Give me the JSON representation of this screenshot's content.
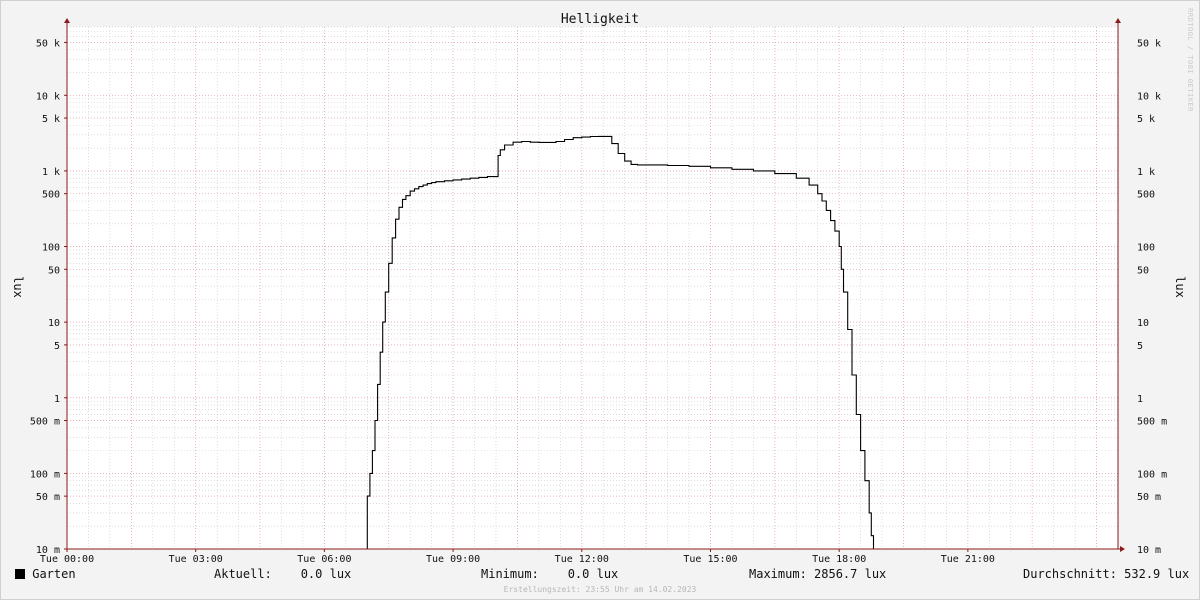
{
  "chart_data": {
    "type": "line",
    "title": "Helligkeit",
    "ylabel": "lux",
    "y_scale": "log",
    "ylim": [
      0.01,
      80000
    ],
    "xlim_hours": [
      0,
      24.5
    ],
    "x_tick_labels": [
      "Tue 00:00",
      "Tue 03:00",
      "Tue 06:00",
      "Tue 09:00",
      "Tue 12:00",
      "Tue 15:00",
      "Tue 18:00",
      "Tue 21:00"
    ],
    "x_tick_hours": [
      0,
      3,
      6,
      9,
      12,
      15,
      18,
      21
    ],
    "y_tick_values": [
      0.01,
      0.05,
      0.1,
      0.5,
      1,
      5,
      10,
      50,
      100,
      500,
      1000,
      5000,
      10000,
      50000
    ],
    "y_tick_labels": [
      "10 m",
      "50 m",
      "100 m",
      "500 m",
      "1",
      "5",
      "10",
      "50",
      "100",
      "500",
      "1 k",
      "5 k",
      "10 k",
      "50 k"
    ],
    "grid": true,
    "series": [
      {
        "name": "Garten",
        "color": "#000000",
        "x_hours": [
          0,
          6.0,
          6.87,
          7.0,
          7.06,
          7.12,
          7.18,
          7.24,
          7.3,
          7.36,
          7.42,
          7.5,
          7.58,
          7.66,
          7.74,
          7.82,
          7.9,
          8.0,
          8.1,
          8.2,
          8.3,
          8.4,
          8.5,
          8.6,
          8.8,
          9.0,
          9.2,
          9.4,
          9.6,
          9.8,
          10.05,
          10.1,
          10.2,
          10.4,
          10.6,
          10.8,
          11.0,
          11.2,
          11.4,
          11.6,
          11.8,
          12.0,
          12.2,
          12.4,
          12.7,
          12.85,
          13.0,
          13.15,
          13.3,
          13.5,
          14.0,
          14.5,
          15.0,
          15.5,
          16.0,
          16.5,
          17.0,
          17.3,
          17.5,
          17.6,
          17.7,
          17.8,
          17.9,
          18.0,
          18.05,
          18.1,
          18.2,
          18.3,
          18.4,
          18.5,
          18.6,
          18.7,
          18.75,
          18.8,
          18.85,
          18.9,
          18.95,
          19.0,
          19.05,
          19.1,
          19.2,
          21.0,
          24.0
        ],
        "values": [
          0.01,
          0.01,
          0.01,
          0.05,
          0.1,
          0.2,
          0.5,
          1.5,
          4,
          10,
          25,
          60,
          130,
          230,
          330,
          420,
          470,
          540,
          580,
          620,
          650,
          680,
          700,
          720,
          740,
          760,
          780,
          800,
          820,
          840,
          1600,
          1900,
          2200,
          2400,
          2450,
          2400,
          2380,
          2380,
          2450,
          2600,
          2750,
          2800,
          2850,
          2856.7,
          2300,
          1700,
          1350,
          1220,
          1200,
          1200,
          1180,
          1150,
          1100,
          1050,
          1000,
          920,
          800,
          650,
          500,
          400,
          300,
          220,
          160,
          100,
          50,
          25,
          8,
          2,
          0.6,
          0.2,
          0.08,
          0.03,
          0.015,
          0.01,
          0.01,
          0.01,
          0.01,
          0.01,
          0.01,
          0.01,
          0.01,
          0.01,
          0.01
        ]
      }
    ]
  },
  "legend": {
    "series_name": "Garten",
    "swatch_color": "#000000",
    "aktuell": "Aktuell:    0.0 lux",
    "minimum": "Minimum:    0.0 lux",
    "maximum": "Maximum: 2856.7 lux",
    "durchschnitt": "Durchschnitt: 532.9 lux"
  },
  "watermark": "RRDTOOL / TOBI OETIKER",
  "credit": "Erstellungszeit: 23:55 Uhr am 14.02.2023",
  "colors": {
    "background": "#f3f3f3",
    "plot_background": "#ffffff",
    "major_grid": "#e8a0a8",
    "minor_grid": "#c8c8c8",
    "axis": "#8b1a1a"
  }
}
